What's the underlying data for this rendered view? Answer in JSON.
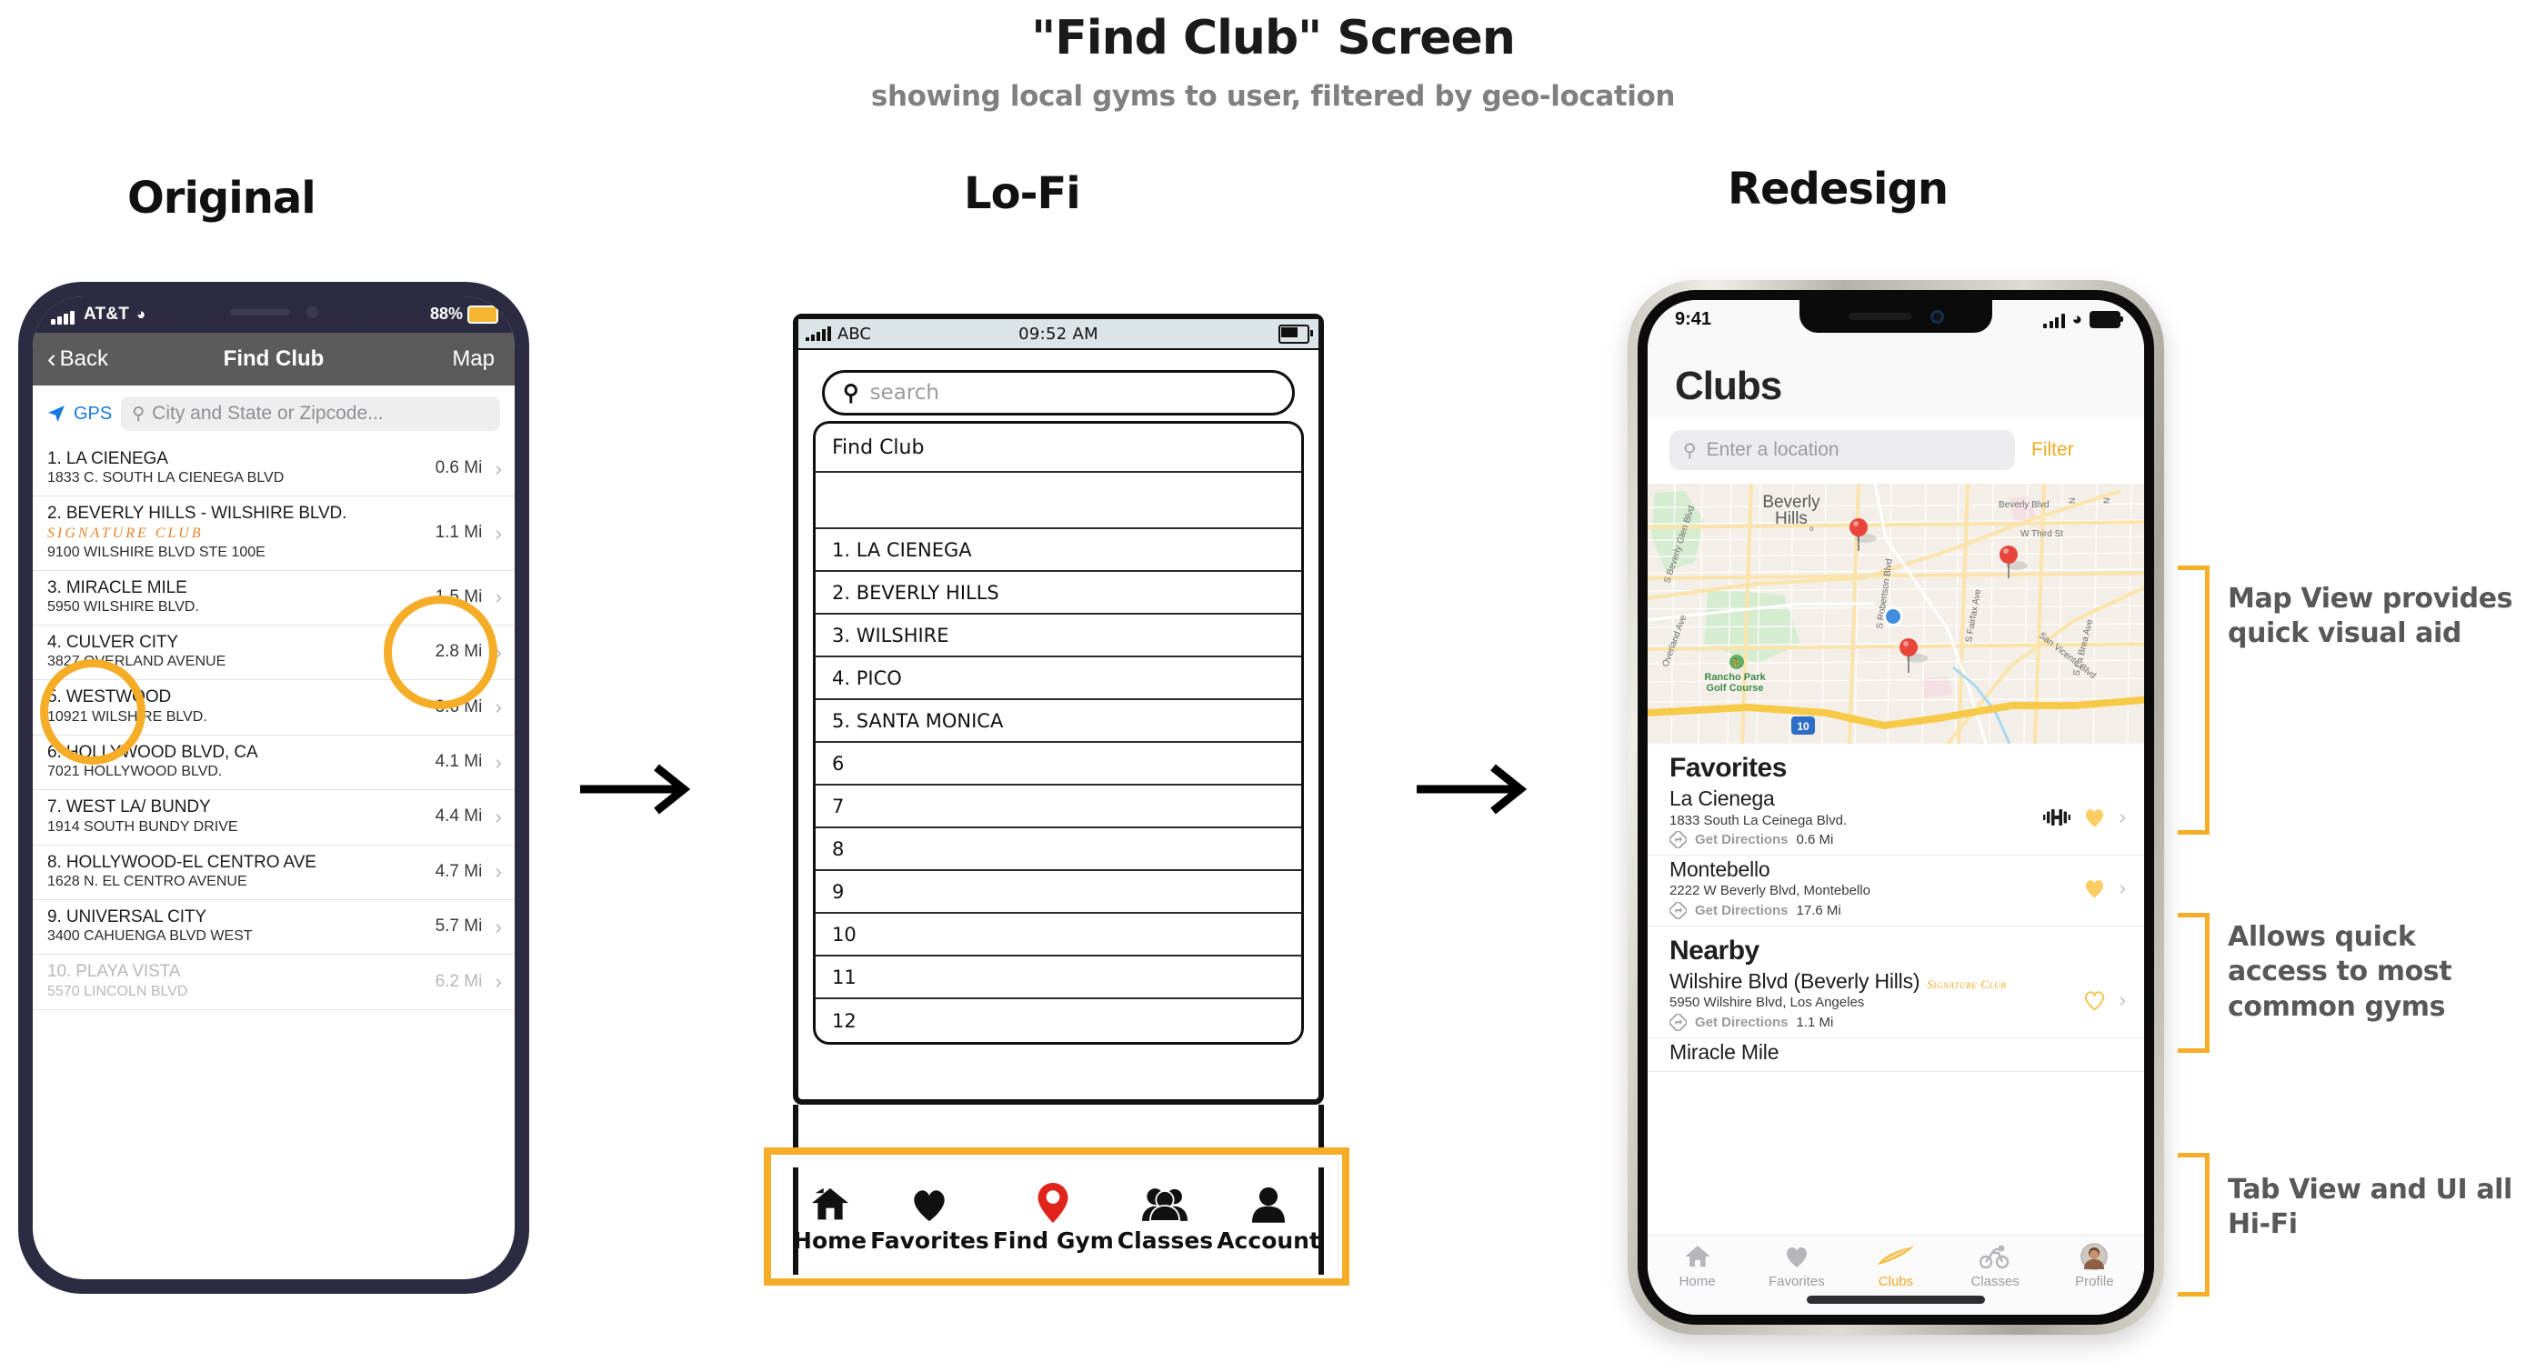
{
  "header": {
    "title": "\"Find Club\" Screen",
    "subtitle": "showing local gyms to user, filtered by geo-location"
  },
  "columns": {
    "original": "Original",
    "lofi": "Lo-Fi",
    "redesign": "Redesign"
  },
  "original": {
    "status": {
      "carrier": "AT&T",
      "battery": "88%"
    },
    "nav": {
      "back": "Back",
      "title": "Find Club",
      "map": "Map"
    },
    "search": {
      "gps_label": "GPS",
      "placeholder": "City and State or Zipcode..."
    },
    "list": [
      {
        "name": "1. LA CIENEGA",
        "address": "1833 C. SOUTH LA CIENEGA BLVD",
        "distance": "0.6 Mi",
        "badge": ""
      },
      {
        "name": "2. BEVERLY HILLS - WILSHIRE BLVD.",
        "address": "9100 WILSHIRE BLVD STE 100E",
        "distance": "1.1 Mi",
        "badge": "SIGNATURE CLUB"
      },
      {
        "name": "3. MIRACLE MILE",
        "address": "5950 WILSHIRE BLVD.",
        "distance": "1.5 Mi",
        "badge": ""
      },
      {
        "name": "4. CULVER CITY",
        "address": "3827 OVERLAND AVENUE",
        "distance": "2.8 Mi",
        "badge": ""
      },
      {
        "name": "5. WESTWOOD",
        "address": "10921 WILSHIRE BLVD.",
        "distance": "3.6 Mi",
        "badge": ""
      },
      {
        "name": "6. HOLLYWOOD BLVD, CA",
        "address": "7021 HOLLYWOOD BLVD.",
        "distance": "4.1 Mi",
        "badge": ""
      },
      {
        "name": "7. WEST LA/ BUNDY",
        "address": "1914 SOUTH BUNDY DRIVE",
        "distance": "4.4 Mi",
        "badge": ""
      },
      {
        "name": "8. HOLLYWOOD-EL CENTRO AVE",
        "address": "1628 N. EL CENTRO AVENUE",
        "distance": "4.7 Mi",
        "badge": ""
      },
      {
        "name": "9. UNIVERSAL CITY",
        "address": "3400 CAHUENGA BLVD WEST",
        "distance": "5.7 Mi",
        "badge": ""
      },
      {
        "name": "10. PLAYA VISTA",
        "address": "5570 LINCOLN BLVD",
        "distance": "6.2 Mi",
        "badge": ""
      }
    ]
  },
  "lofi": {
    "status": {
      "carrier": "ABC",
      "time": "09:52 AM"
    },
    "search_placeholder": "search",
    "card_header": "Find Club",
    "rows": [
      "",
      "1. LA CIENEGA",
      "2. BEVERLY HILLS",
      "3. WILSHIRE",
      "4. PICO",
      "5. SANTA MONICA",
      "6",
      "7",
      "8",
      "9",
      "10",
      "11",
      "12"
    ],
    "tabs": [
      {
        "label": "Home",
        "icon": "home-icon"
      },
      {
        "label": "Favorites",
        "icon": "heart-icon"
      },
      {
        "label": "Find Gym",
        "icon": "map-pin-icon"
      },
      {
        "label": "Classes",
        "icon": "people-icon"
      },
      {
        "label": "Account",
        "icon": "person-icon"
      }
    ]
  },
  "redesign": {
    "status": {
      "time": "9:41"
    },
    "page_title": "Clubs",
    "search": {
      "placeholder": "Enter a location",
      "filter_label": "Filter"
    },
    "map": {
      "labels": [
        "Beverly Hills",
        "Beverly Blvd",
        "W Third St",
        "S Beverly Glen Blvd",
        "S Robertson Blvd",
        "S Fairfax Ave",
        "San Vicente Blvd",
        "S La Brea Ave",
        "Overland Ave",
        "Rancho Park Golf Course",
        "10"
      ],
      "pins": 3,
      "user_location": true
    },
    "sections": [
      {
        "title": "Favorites",
        "items": [
          {
            "name": "La Cienega",
            "badge": "",
            "address": "1833 South La Ceinega Blvd.",
            "directions": "Get Directions",
            "distance": "0.6 Mi",
            "heart": "filled",
            "gym_icon": true
          },
          {
            "name": "Montebello",
            "badge": "",
            "address": "2222 W Beverly Blvd, Montebello",
            "directions": "Get Directions",
            "distance": "17.6 Mi",
            "heart": "filled",
            "gym_icon": false
          }
        ]
      },
      {
        "title": "Nearby",
        "items": [
          {
            "name": "Wilshire Blvd (Beverly Hills)",
            "badge": "Signature Club",
            "address": "5950 Wilshire Blvd, Los Angeles",
            "directions": "Get Directions",
            "distance": "1.1 Mi",
            "heart": "outline",
            "gym_icon": false
          },
          {
            "name": "Miracle Mile",
            "badge": "",
            "address": "",
            "directions": "",
            "distance": "",
            "heart": "",
            "gym_icon": false
          }
        ]
      }
    ],
    "tabs": [
      {
        "label": "Home",
        "icon": "home-icon",
        "active": false
      },
      {
        "label": "Favorites",
        "icon": "heart-icon",
        "active": false
      },
      {
        "label": "Clubs",
        "icon": "swoosh-icon",
        "active": true
      },
      {
        "label": "Classes",
        "icon": "cycling-icon",
        "active": false
      },
      {
        "label": "Profile",
        "icon": "avatar-icon",
        "active": false
      }
    ]
  },
  "annotations": [
    "Map View provides quick visual aid",
    "Allows quick access to most common gyms",
    "Tab View and UI all Hi-Fi"
  ],
  "colors": {
    "accent": "#f5ac27",
    "signature": "#e8822a",
    "heart": "#fbcd63",
    "muted_text": "#58585a"
  }
}
